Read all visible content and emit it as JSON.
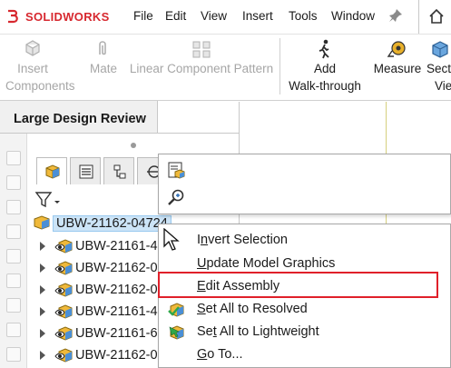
{
  "app": {
    "brand": "SOLIDWORKS",
    "brand_prefix": "3S",
    "brand_color": "#d7282f"
  },
  "menubar": {
    "items": [
      "File",
      "Edit",
      "View",
      "Insert",
      "Tools",
      "Window"
    ],
    "pin_icon": "pin-icon",
    "home_icon": "home-icon"
  },
  "ribbon": {
    "insert_components": [
      "Insert",
      "Components"
    ],
    "mate": "Mate",
    "linear_pattern": "Linear Component Pattern",
    "add_walkthrough": [
      "Add",
      "Walk-through"
    ],
    "measure": "Measure",
    "section_view": [
      "Sect",
      "Vie"
    ]
  },
  "panel": {
    "tab_title": "Large Design Review"
  },
  "tree": {
    "root": "UBW-21162-04724",
    "children": [
      "UBW-21161-4",
      "UBW-21162-0",
      "UBW-21162-0",
      "UBW-21161-4",
      "UBW-21161-6",
      "UBW-21162-0"
    ]
  },
  "context_menu": {
    "items": [
      {
        "pre": "I",
        "accel": "n",
        "post": "vert Selection"
      },
      {
        "pre": "",
        "accel": "U",
        "post": "pdate Model Graphics"
      },
      {
        "pre": "",
        "accel": "E",
        "post": "dit Assembly"
      },
      {
        "pre": "",
        "accel": "S",
        "post": "et All to Resolved"
      },
      {
        "pre": "Se",
        "accel": "t",
        "post": " All to Lightweight"
      },
      {
        "pre": "",
        "accel": "G",
        "post": "o To..."
      }
    ],
    "highlight_color": "#e0202a",
    "selection_color": "#cce4f7"
  }
}
